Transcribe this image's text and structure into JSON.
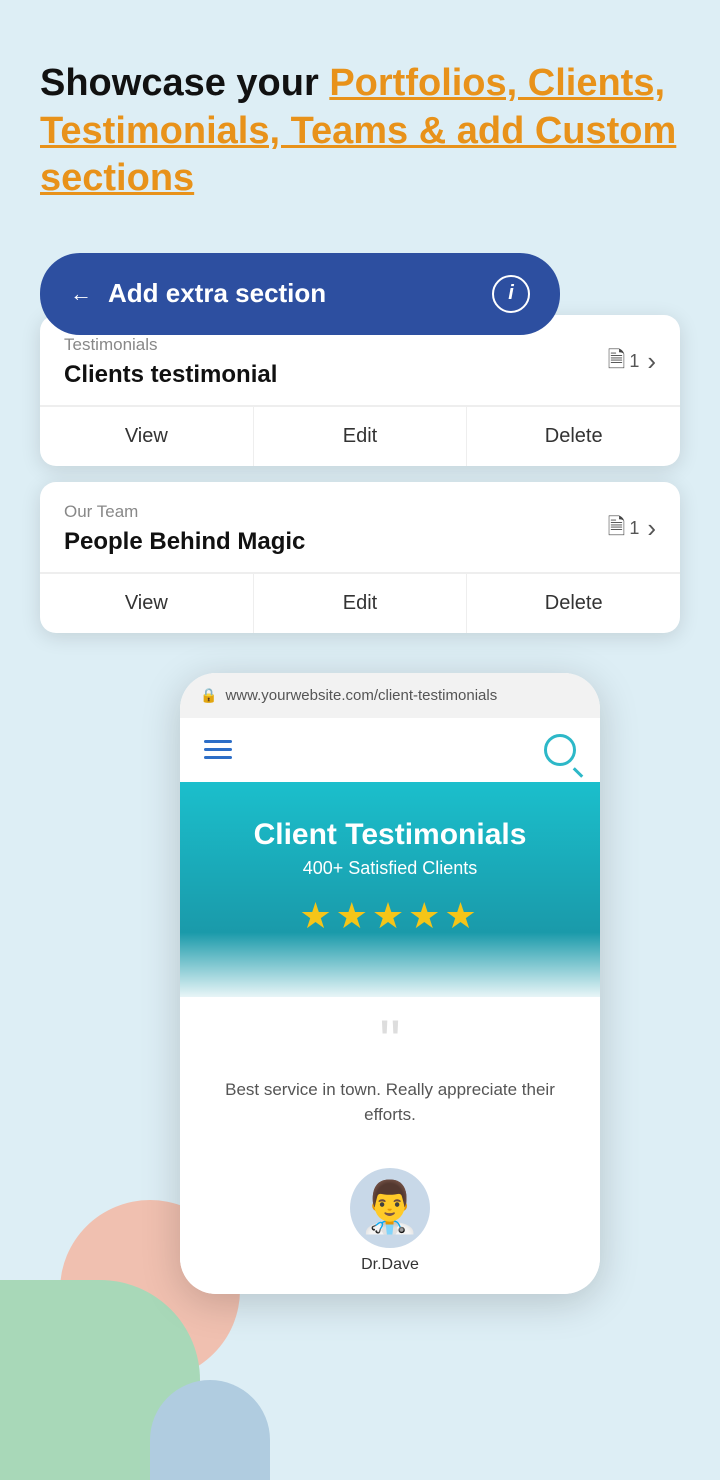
{
  "headline": {
    "prefix": "Showcase your ",
    "highlight": "Portfolios, Clients, Testimonials, Teams & add Custom sections"
  },
  "add_section_bar": {
    "back_label": "←",
    "label": "Add extra section",
    "info_label": "i"
  },
  "cards": [
    {
      "type": "Testimonials",
      "title": "Clients testimonial",
      "count": "1",
      "actions": [
        "View",
        "Edit",
        "Delete"
      ]
    },
    {
      "type": "Our Team",
      "title": "People Behind Magic",
      "count": "1",
      "actions": [
        "View",
        "Edit",
        "Delete"
      ]
    }
  ],
  "phone": {
    "url": "www.yourwebsite.com/client-testimonials",
    "nav_hamburger": true,
    "banner": {
      "title": "Client Testimonials",
      "subtitle": "400+ Satisfied Clients",
      "stars": "★★★★★"
    },
    "quote": {
      "text": "Best service in town. Really appreciate their efforts.",
      "author": "Dr.Dave"
    }
  }
}
